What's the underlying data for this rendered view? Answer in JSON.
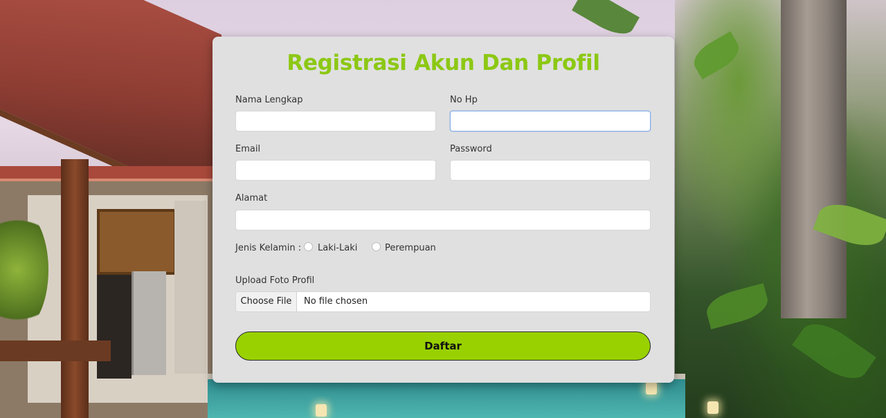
{
  "form": {
    "title": "Registrasi Akun Dan Profil",
    "nama_label": "Nama Lengkap",
    "nama_value": "",
    "hp_label": "No Hp",
    "hp_value": "",
    "email_label": "Email",
    "email_value": "",
    "password_label": "Password",
    "password_value": "",
    "alamat_label": "Alamat",
    "alamat_value": "",
    "gender_label": "Jenis Kelamin :",
    "gender_options": [
      "Laki-Laki",
      "Perempuan"
    ],
    "upload_label": "Upload Foto Profil",
    "file_button": "Choose File",
    "file_status": "No file chosen",
    "submit_label": "Daftar"
  },
  "colors": {
    "accent": "#99d100",
    "title": "#8cc814",
    "card_bg": "#e0e0e0"
  }
}
